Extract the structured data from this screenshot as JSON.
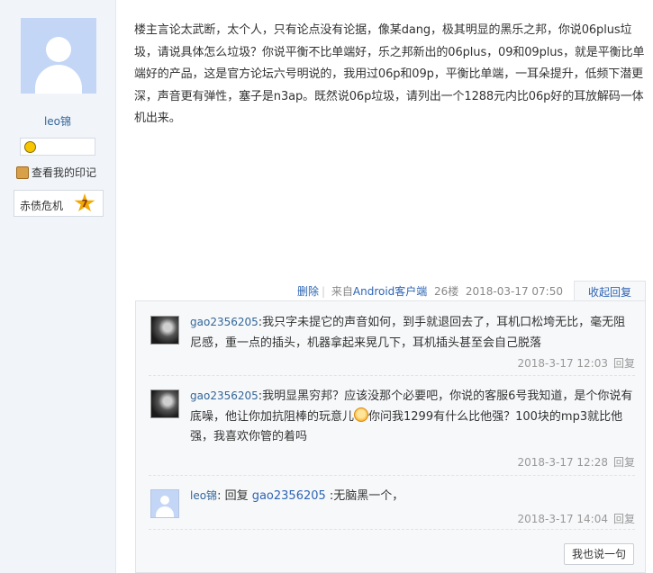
{
  "sidebar": {
    "username": "leo锦",
    "impress_link": "查看我的印记",
    "level_name": "赤债危机",
    "level_num": "7"
  },
  "post": {
    "text": "楼主言论太武断，太个人，只有论点没有论据，像某dang，极其明显的黑乐之邦，你说06plus垃圾，请说具体怎么垃圾？你说平衡不比单端好，乐之邦新出的06plus，09和09plus，就是平衡比单端好的产品，这是官方论坛六号明说的，我用过06p和09p，平衡比单端，一耳朵提升，低频下潜更深，声音更有弹性，塞子是n3ap。既然说06p垃圾，请列出一个1288元内比06p好的耳放解码一体机出来。"
  },
  "meta": {
    "delete": "删除",
    "sep": "|",
    "source_prefix": "来自",
    "source": "Android客户端",
    "floor": "26楼",
    "time": "2018-03-17 07:50",
    "collapse": "收起回复"
  },
  "replies": [
    {
      "author": "gao2356205",
      "colon": ":",
      "text": "我只字未提它的声音如何，到手就退回去了，耳机口松垮无比，毫无阻尼感，重一点的插头，机器拿起来晃几下，耳机插头甚至会自己脱落",
      "time": "2018-3-17 12:03",
      "reply": "回复"
    },
    {
      "author": "gao2356205",
      "colon": ":",
      "text_a": "我明显黑穷邦？应该没那个必要吧，你说的客服6号我知道，是个你说有底噪，他让你加抗阻棒的玩意儿",
      "text_b": "你问我1299有什么比他强？100块的mp3就比他强，我喜欢你管的着吗",
      "time": "2018-3-17 12:28",
      "reply": "回复"
    },
    {
      "author": "leo锦",
      "colon": ": ",
      "reply_word": "回复 ",
      "mention": "gao2356205",
      "text": " :无脑黑一个，",
      "time": "2018-3-17 14:04",
      "reply": "回复"
    }
  ],
  "say_button": "我也说一句",
  "colors": {
    "link": "#2d64b3",
    "name": "#336699",
    "sidebar_bg": "#f1f5fa",
    "reply_bg": "#f7f8fa"
  }
}
